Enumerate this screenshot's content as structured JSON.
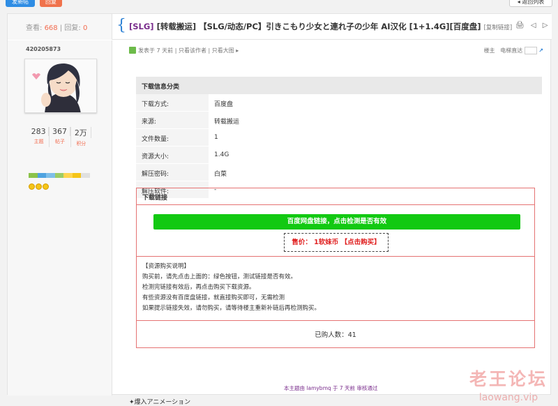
{
  "topbar": {
    "post_btn": "发新帖",
    "reply_btn": "回复",
    "back_btn": "◂ 返回列表"
  },
  "header": {
    "views_label": "查看:",
    "views": "668",
    "sep": " | ",
    "replies_label": "回复:",
    "replies": "0",
    "title_tag": "[SLG]",
    "title_main": " [转载搬运] 【SLG/动态/PC】引きこもり少女と連れ子の少年 AI汉化 [1+1.4G][百度盘] ",
    "copy_link": "[复制链接]",
    "icons": "🖨 ◁ ▷"
  },
  "user": {
    "name": "420205873",
    "stats": [
      {
        "value": "283",
        "label": "主题"
      },
      {
        "value": "367",
        "label": "帖子"
      },
      {
        "value": "2万",
        "label": "积分"
      }
    ]
  },
  "meta": {
    "posted": "发表于 7 天前",
    "sep": " | ",
    "only_author": "只看该作者",
    "only_big": "只看大图 ▸",
    "floor": "楼主",
    "goto": "电梯直达"
  },
  "download_info": {
    "title": "下载信息分类",
    "rows": [
      {
        "k": "下载方式:",
        "v": "百度盘"
      },
      {
        "k": "来源:",
        "v": "转载搬运"
      },
      {
        "k": "文件数量:",
        "v": "1"
      },
      {
        "k": "资源大小:",
        "v": "1.4G"
      },
      {
        "k": "解压密码:",
        "v": "白菜"
      },
      {
        "k": "解压软件:",
        "v": "-"
      }
    ]
  },
  "link_box": {
    "title": "下载链接",
    "green_btn": "百度网盘链接，点击检测是否有效",
    "price": "售价： 1软妹币 【点击购买】",
    "notes": [
      "【资源购买说明】",
      "购买前，请先点击上面的：绿色按钮，测试链接是否有效。",
      "检测完链接有效后，再点击购买下载资源。",
      "有些资源没有百度盘链接，就直接购买即可，无需检测",
      "如果提示链接失效，请勿购买，请等待楼主重新补链后再检测购买。"
    ],
    "bought": "已购人数：41"
  },
  "review": "本主题由 lamybmq 于 7 天前 审核通过",
  "footer_line": "✦爆入アニメーション",
  "watermark": {
    "cn": "老王论坛",
    "url": "laowang.vip"
  },
  "colors": {
    "accent": "#2a7fd4",
    "green": "#12c912",
    "red": "#e02020",
    "purple": "#7a2d8c"
  }
}
